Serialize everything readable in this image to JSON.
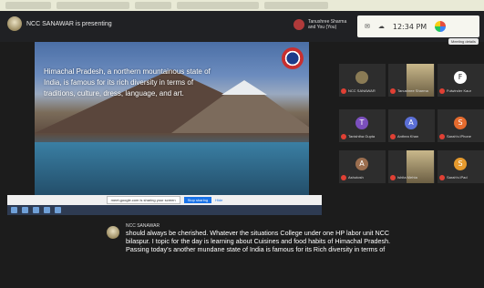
{
  "browser": {
    "tabs": [
      "",
      "",
      "",
      "",
      ""
    ]
  },
  "header": {
    "presenting_label": "NCC SANAWAR is presenting",
    "viewer_name": "Tanushree Sharma and You (You)"
  },
  "tray": {
    "time": "12:34 PM",
    "icon_one": "network-icon",
    "icon_two": "cloud-icon",
    "badge": "Meeting details"
  },
  "slide": {
    "text": "Himachal Pradesh, a northern mountainous state of India, is famous for its rich diversity in terms of traditions, culture, dress, language, and art."
  },
  "share_bar": {
    "notice": "meet.google.com is sharing your screen",
    "stop_label": "Stop sharing",
    "hide_label": "Hide"
  },
  "participants": [
    {
      "initial": "",
      "name": "NCC SANAWAR",
      "color": "#8a7b55",
      "video": false
    },
    {
      "initial": "",
      "name": "Tanushree Sharma",
      "color": "#c9b88b",
      "video": true
    },
    {
      "initial": "F",
      "name": "Fulwinder Kaur",
      "color": "#ffffff",
      "video": false
    },
    {
      "initial": "T",
      "name": "Tanishtha Gupta",
      "color": "#7b4fbd",
      "video": false
    },
    {
      "initial": "A",
      "name": "Anthea Khan",
      "color": "#5b6fd6",
      "video": false
    },
    {
      "initial": "S",
      "name": "Sarah's iPhone",
      "color": "#e56b2e",
      "video": false
    },
    {
      "initial": "A",
      "name": "Ashutosh",
      "color": "#9b6e4f",
      "video": false
    },
    {
      "initial": "",
      "name": "Ishita Mehta",
      "color": "#c9b88b",
      "video": true
    },
    {
      "initial": "S",
      "name": "Sarah's iPad",
      "color": "#e59a2e",
      "video": false
    }
  ],
  "captions": {
    "speaker": "NCC SANAWAR",
    "text": "should always be cherished. Whatever the situations College under one HP labor unit NCC bilaspur. I topic for the day is learning about Cuisines and food habits of Himachal Pradesh. Passing today's another mundane state of India is famous for its Rich diversity in terms of"
  }
}
